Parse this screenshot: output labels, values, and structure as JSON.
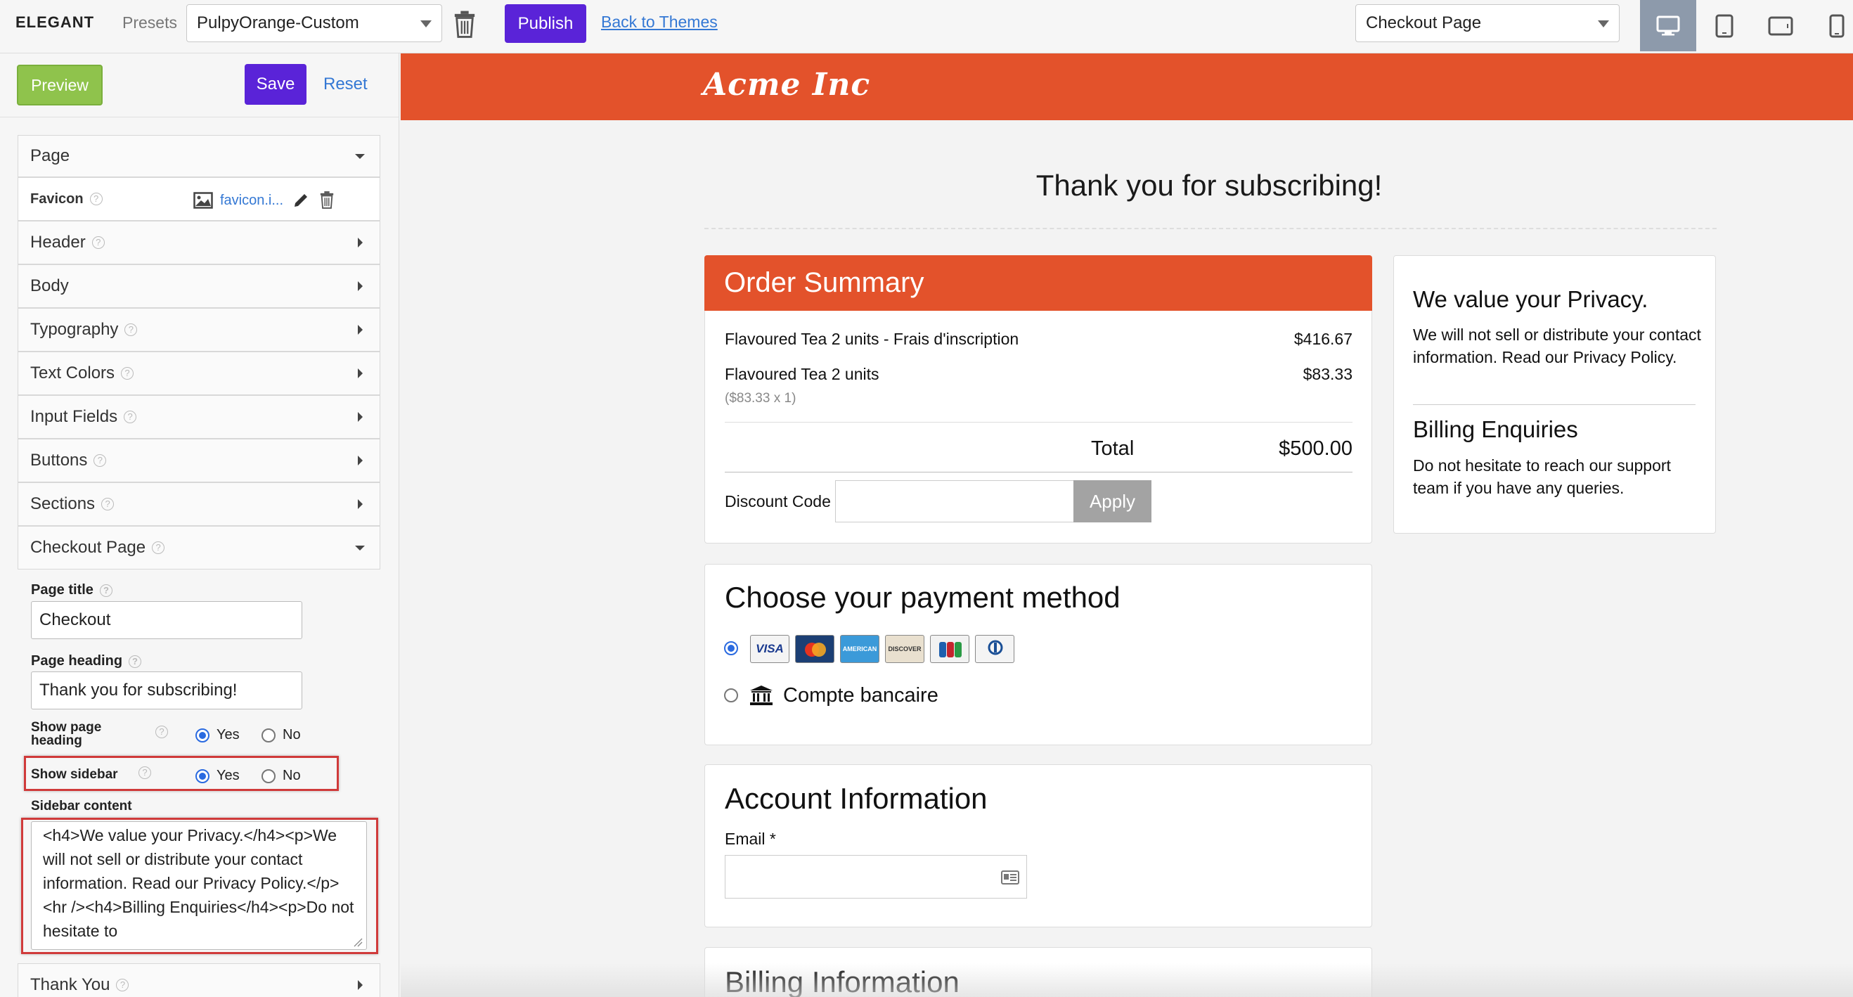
{
  "topbar": {
    "brand": "ELEGANT",
    "presets_label": "Presets",
    "preset_value": "PulpyOrange-Custom",
    "publish_label": "Publish",
    "back_label": "Back to Themes",
    "page_select_value": "Checkout Page",
    "devices": [
      "desktop-icon",
      "tablet-portrait-icon",
      "tablet-landscape-icon",
      "mobile-icon"
    ]
  },
  "left": {
    "preview_label": "Preview",
    "save_label": "Save",
    "reset_label": "Reset",
    "sections": {
      "page": "Page",
      "favicon": "Favicon",
      "favicon_file": "favicon.i...",
      "header": "Header",
      "body": "Body",
      "typography": "Typography",
      "text_colors": "Text Colors",
      "input_fields": "Input Fields",
      "buttons": "Buttons",
      "sections": "Sections",
      "checkout_page": "Checkout Page",
      "thank_you": "Thank You"
    },
    "checkout": {
      "page_title_label": "Page title",
      "page_title_value": "Checkout",
      "page_heading_label": "Page heading",
      "page_heading_value": "Thank you for subscribing!",
      "show_heading_label": "Show page heading",
      "show_sidebar_label": "Show sidebar",
      "yes": "Yes",
      "no": "No",
      "sidebar_content_label": "Sidebar content",
      "sidebar_content_value": "<h4>We value your Privacy.</h4><p>We will not sell or distribute your contact information. Read our Privacy Policy.</p><hr /><h4>Billing Enquiries</h4><p>Do not hesitate to"
    }
  },
  "preview": {
    "logo": "Acme Inc",
    "heading": "Thank you for subscribing!",
    "order": {
      "title": "Order Summary",
      "items": [
        {
          "name": "Flavoured Tea 2 units - Frais d'inscription",
          "price": "$416.67",
          "sub": ""
        },
        {
          "name": "Flavoured Tea 2 units",
          "price": "$83.33",
          "sub": "($83.33 x 1)"
        }
      ],
      "total_label": "Total",
      "total_value": "$500.00",
      "discount_label": "Discount Code",
      "apply_label": "Apply"
    },
    "payment": {
      "title": "Choose your payment method",
      "cards": [
        "VISA",
        "MC",
        "AMEX",
        "DISCOVER",
        "JCB",
        "DINERS"
      ],
      "bank_label": "Compte bancaire"
    },
    "account": {
      "title": "Account Information",
      "email_label": "Email *"
    },
    "billing": {
      "title": "Billing Information"
    },
    "sidebar": {
      "h1": "We value your Privacy.",
      "p1": "We will not sell or distribute your contact information. Read our Privacy Policy.",
      "h2": "Billing Enquiries",
      "p2": "Do not hesitate to reach our support team if you have any queries."
    }
  },
  "colors": {
    "accent": "#e3522b",
    "primary_button": "#5a23d8",
    "preview_button": "#8fc34c",
    "link": "#3478d4",
    "highlight": "#d03a3a"
  }
}
